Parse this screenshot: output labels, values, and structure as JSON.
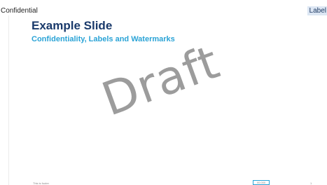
{
  "confidentiality_bar": {
    "left_text": "Confidential",
    "right_label": "Label"
  },
  "slide": {
    "title": "Example Slide",
    "subtitle": "Confidentiality, Labels and Watermarks",
    "watermark": "Draft",
    "footer": {
      "left_text": "This is footer",
      "box_text": "00.000",
      "page_number": "1"
    }
  },
  "colors": {
    "title": "#1a3a6b",
    "subtitle": "#2aa3d6",
    "watermark": "#9c9c9c",
    "label_bg": "#dce6f3"
  }
}
